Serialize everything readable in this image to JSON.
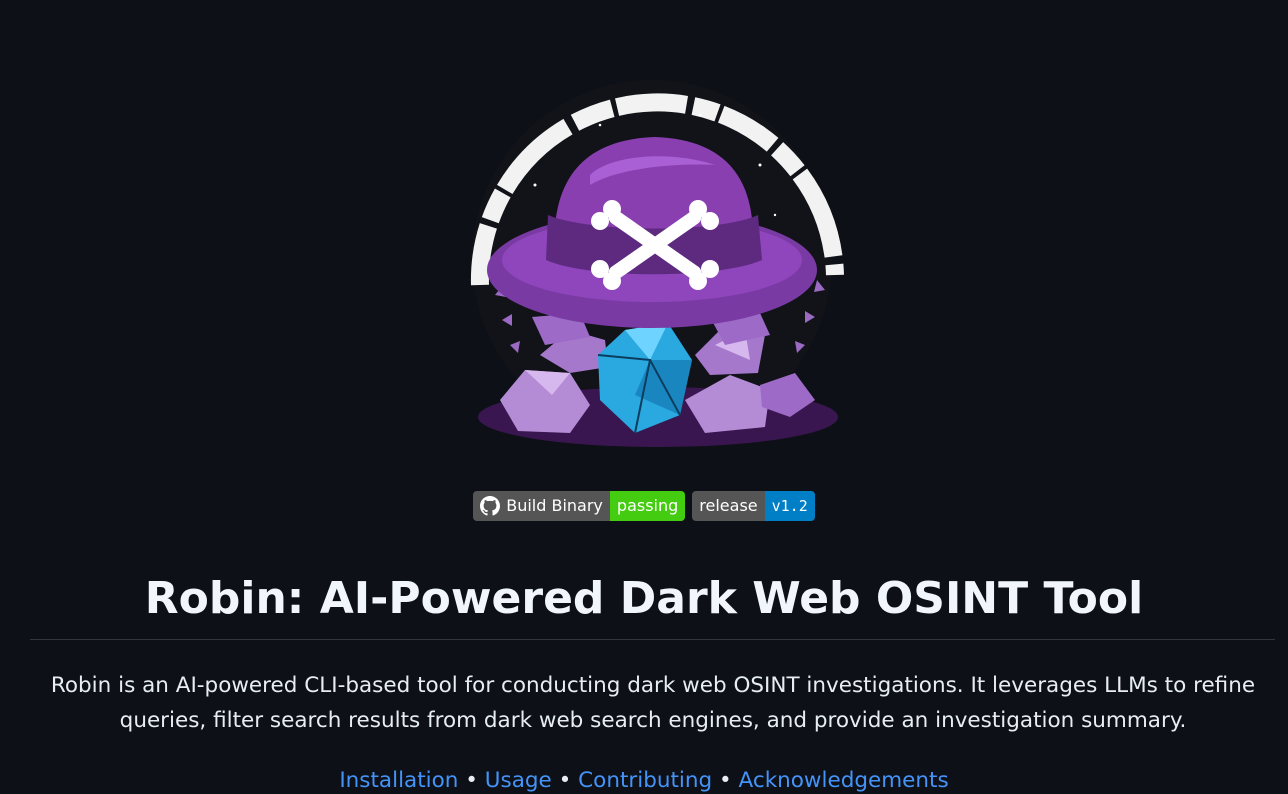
{
  "badges": [
    {
      "label": "Build Binary",
      "status": "passing",
      "status_color": "#44cc11",
      "icon": "github-icon"
    },
    {
      "label": "release",
      "status": "v1.2",
      "status_color": "#007ec6"
    }
  ],
  "title": "Robin: AI-Powered Dark Web OSINT Tool",
  "description": "Robin is an AI-powered CLI-based tool for conducting dark web OSINT investigations. It leverages LLMs to refine queries, filter search results from dark web search engines, and provide an investigation summary.",
  "nav_links": [
    {
      "label": "Installation"
    },
    {
      "label": "Usage"
    },
    {
      "label": "Contributing"
    },
    {
      "label": "Acknowledgements"
    }
  ],
  "separator": "•",
  "colors": {
    "background": "#0d1117",
    "link": "#4493f8",
    "hat_purple": "#8a3fb0",
    "crystal_purple": "#b48cd6",
    "dice_blue": "#2aa8e0"
  }
}
